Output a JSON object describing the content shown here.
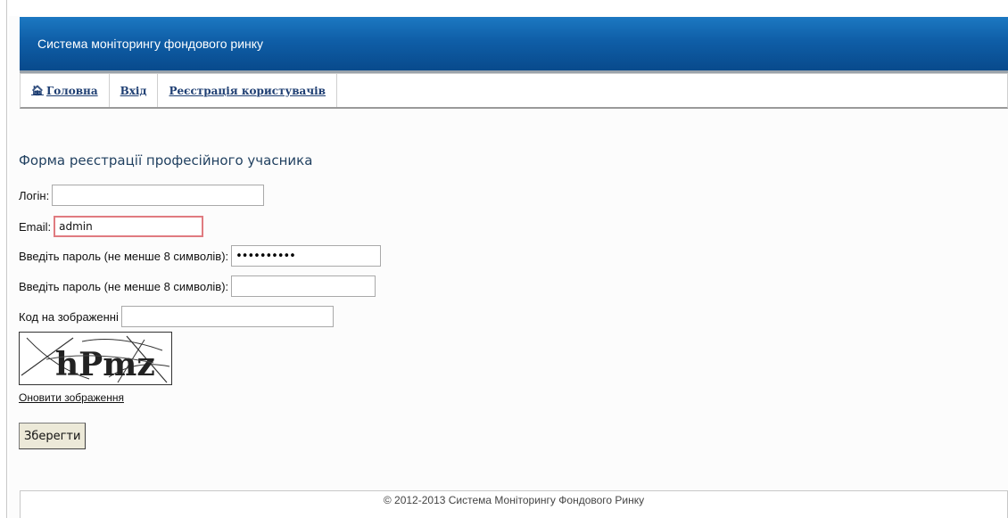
{
  "header": {
    "title": "Система моніторингу фондового ринку"
  },
  "nav": {
    "home": "Головна",
    "login": "Вхід",
    "register": "Реєстрація користувачів"
  },
  "form": {
    "title": "Форма реєстрації професійного учасника",
    "login_label": "Логін:",
    "login_value": "",
    "email_label": "Email:",
    "email_value": "admin",
    "password_label": "Введіть пароль (не менше 8 символів):",
    "password_value": "••••••••••",
    "password_confirm_label": "Введіть пароль (не менше 8 символів):",
    "password_confirm_value": "",
    "captcha_label": "Код на зображенні",
    "captcha_value": "",
    "captcha_text": "hPmz",
    "refresh_label": "Оновити зображення",
    "save_label": "Зберегти"
  },
  "footer": {
    "text": "© 2012-2013 Система Моніторингу Фондового Ринку"
  },
  "colors": {
    "banner": "#0f5ea7",
    "nav_link": "#1f3f73",
    "focus_border": "#e07b80"
  }
}
